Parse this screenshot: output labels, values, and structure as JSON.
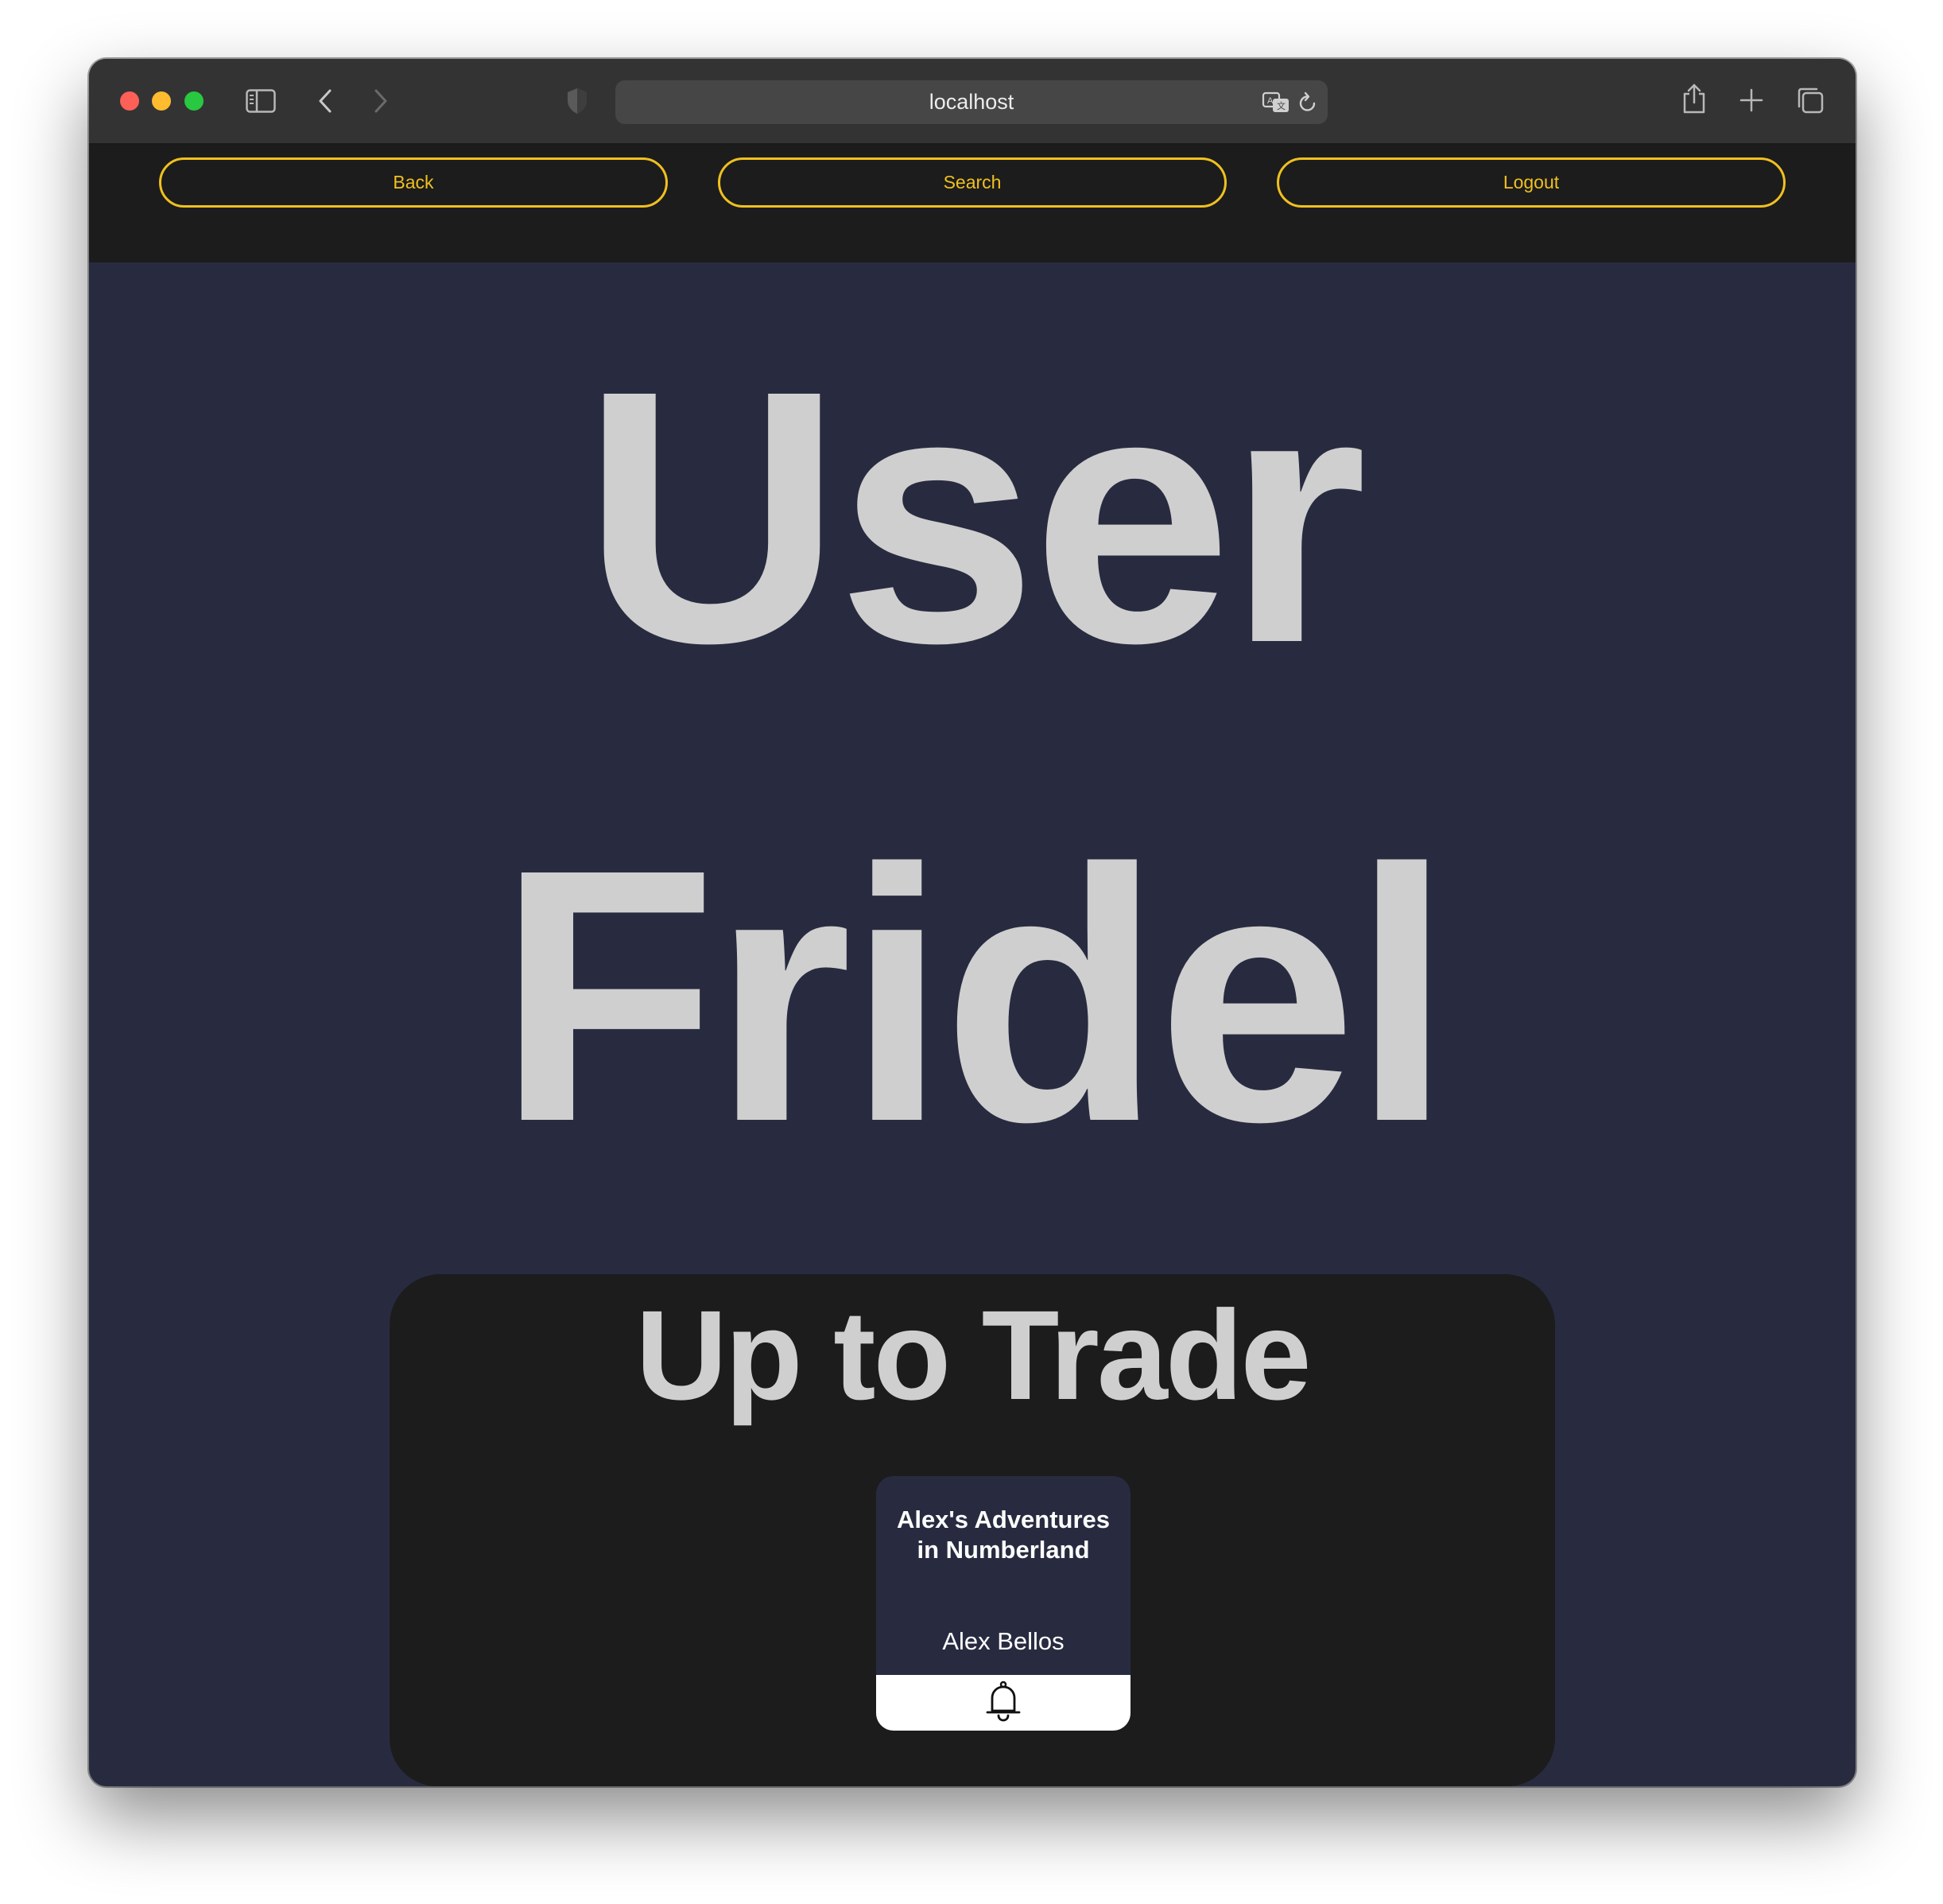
{
  "browser": {
    "url": "localhost",
    "traffic_lights": {
      "close": "#fe5f57",
      "minimize": "#febc2e",
      "zoom": "#28c840"
    }
  },
  "nav": {
    "back_label": "Back",
    "search_label": "Search",
    "logout_label": "Logout",
    "accent_color": "#f0c020"
  },
  "profile": {
    "heading": "User",
    "username": "Fridel"
  },
  "trade_section": {
    "title": "Up to Trade",
    "books": [
      {
        "title": "Alex's Adventures in Numberland",
        "author": "Alex Bellos",
        "action_icon": "bell-icon"
      }
    ]
  },
  "colors": {
    "page_background": "#282b40",
    "panel_background": "#1c1c1c",
    "heading_text": "#cfcfcf"
  }
}
